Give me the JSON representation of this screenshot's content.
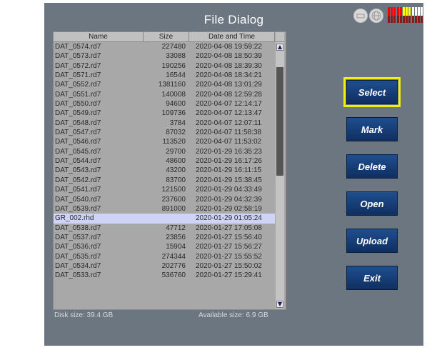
{
  "dialog": {
    "title": "File Dialog"
  },
  "table": {
    "columns": [
      "Name",
      "Size",
      "Date and Time"
    ],
    "rows": [
      {
        "name": "DAT_0574.rd7",
        "size": "227480",
        "date": "2020-04-08 19:59:22"
      },
      {
        "name": "DAT_0573.rd7",
        "size": "33088",
        "date": "2020-04-08 18:50:39"
      },
      {
        "name": "DAT_0572.rd7",
        "size": "190256",
        "date": "2020-04-08 18:39:30"
      },
      {
        "name": "DAT_0571.rd7",
        "size": "16544",
        "date": "2020-04-08 18:34:21"
      },
      {
        "name": "DAT_0552.rd7",
        "size": "1381160",
        "date": "2020-04-08 13:01:29"
      },
      {
        "name": "DAT_0551.rd7",
        "size": "140008",
        "date": "2020-04-08 12:59:28"
      },
      {
        "name": "DAT_0550.rd7",
        "size": "94600",
        "date": "2020-04-07 12:14:17"
      },
      {
        "name": "DAT_0549.rd7",
        "size": "109736",
        "date": "2020-04-07 12:13:47"
      },
      {
        "name": "DAT_0548.rd7",
        "size": "3784",
        "date": "2020-04-07 12:07:11"
      },
      {
        "name": "DAT_0547.rd7",
        "size": "87032",
        "date": "2020-04-07 11:58:38"
      },
      {
        "name": "DAT_0546.rd7",
        "size": "113520",
        "date": "2020-04-07 11:53:02"
      },
      {
        "name": "DAT_0545.rd7",
        "size": "29700",
        "date": "2020-01-29 16:35:23"
      },
      {
        "name": "DAT_0544.rd7",
        "size": "48600",
        "date": "2020-01-29 16:17:26"
      },
      {
        "name": "DAT_0543.rd7",
        "size": "43200",
        "date": "2020-01-29 16:11:15"
      },
      {
        "name": "DAT_0542.rd7",
        "size": "83700",
        "date": "2020-01-29 15:38:45"
      },
      {
        "name": "DAT_0541.rd7",
        "size": "121500",
        "date": "2020-01-29 04:33:49"
      },
      {
        "name": "DAT_0540.rd7",
        "size": "237600",
        "date": "2020-01-29 04:32:39"
      },
      {
        "name": "DAT_0539.rd7",
        "size": "891000",
        "date": "2020-01-29 02:58:19"
      },
      {
        "name": "GR_002.rhd",
        "size": "",
        "date": "2020-01-29 01:05:24",
        "highlighted": true
      },
      {
        "name": "DAT_0538.rd7",
        "size": "47712",
        "date": "2020-01-27 17:05:08"
      },
      {
        "name": "DAT_0537.rd7",
        "size": "23856",
        "date": "2020-01-27 15:56:40"
      },
      {
        "name": "DAT_0536.rd7",
        "size": "15904",
        "date": "2020-01-27 15:56:27"
      },
      {
        "name": "DAT_0535.rd7",
        "size": "274344",
        "date": "2020-01-27 15:55:52"
      },
      {
        "name": "DAT_0534.rd7",
        "size": "202776",
        "date": "2020-01-27 15:50:02"
      },
      {
        "name": "DAT_0533.rd7",
        "size": "536760",
        "date": "2020-01-27 15:29:41"
      }
    ]
  },
  "footer": {
    "disk_size": "Disk size: 39.4 GB",
    "available_size": "Available size: 6.9 GB"
  },
  "buttons": [
    {
      "id": "select",
      "label": "Select",
      "selected": true
    },
    {
      "id": "mark",
      "label": "Mark"
    },
    {
      "id": "delete",
      "label": "Delete"
    },
    {
      "id": "open",
      "label": "Open"
    },
    {
      "id": "upload",
      "label": "Upload"
    },
    {
      "id": "exit",
      "label": "Exit"
    }
  ],
  "status_icons": [
    "storage-icon",
    "globe-icon",
    "level-meter-icon"
  ],
  "colors": {
    "panel_bg": "#6b7681",
    "table_bg": "#a8a8a8",
    "highlight_row": "#cfd4f7",
    "button_bg": "#1a3f7a",
    "selected_outline": "#f2ee0c"
  }
}
